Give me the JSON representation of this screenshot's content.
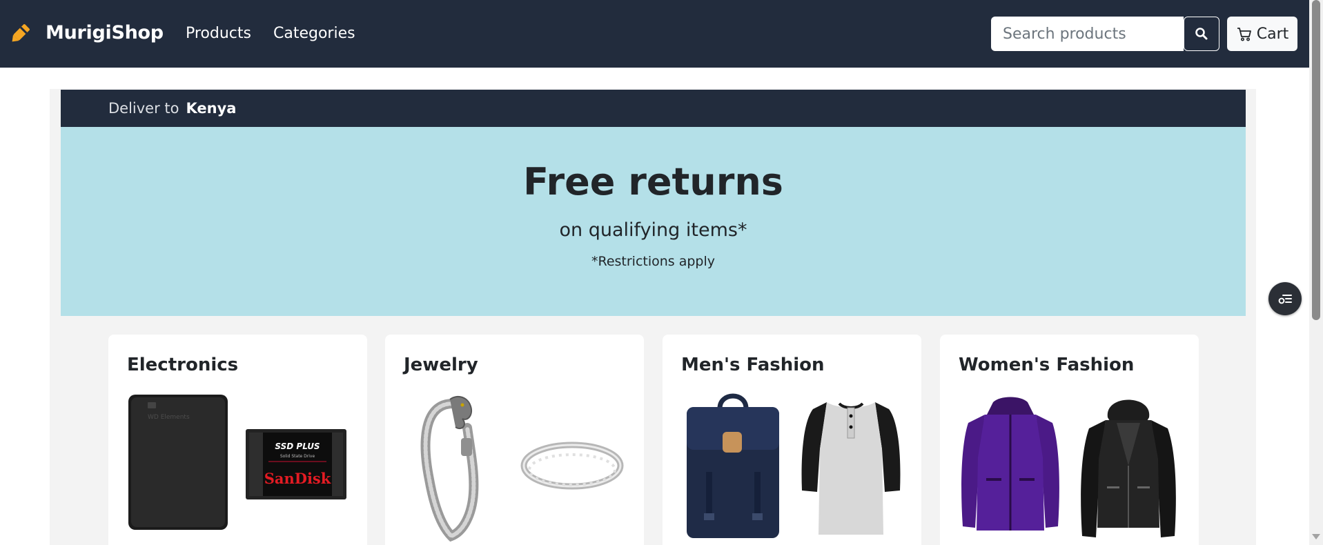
{
  "brand": {
    "name": "MurigiShop",
    "icon": "pencil-icon",
    "accent": "#f5a623"
  },
  "nav": {
    "links": [
      {
        "label": "Products"
      },
      {
        "label": "Categories"
      }
    ]
  },
  "search": {
    "placeholder": "Search products",
    "button_icon": "search-icon"
  },
  "cart": {
    "label": "Cart",
    "icon": "cart-icon"
  },
  "deliver": {
    "prefix": "Deliver to",
    "country": "Kenya"
  },
  "hero": {
    "title": "Free returns",
    "subtitle": "on qualifying items*",
    "note": "*Restrictions apply"
  },
  "categories": [
    {
      "title": "Electronics",
      "images": [
        "external-hard-drive-image",
        "ssd-image"
      ]
    },
    {
      "title": "Jewelry",
      "images": [
        "bracelet-image",
        "ring-image"
      ]
    },
    {
      "title": "Men's Fashion",
      "images": [
        "backpack-image",
        "raglan-shirt-image"
      ]
    },
    {
      "title": "Women's Fashion",
      "images": [
        "purple-jacket-image",
        "leather-jacket-image"
      ]
    }
  ],
  "colors": {
    "navbar": "#222c3d",
    "hero_bg": "#b4e0e8",
    "page_bg": "#f3f3f3"
  },
  "floating_action": {
    "icon": "settings-list-icon"
  }
}
